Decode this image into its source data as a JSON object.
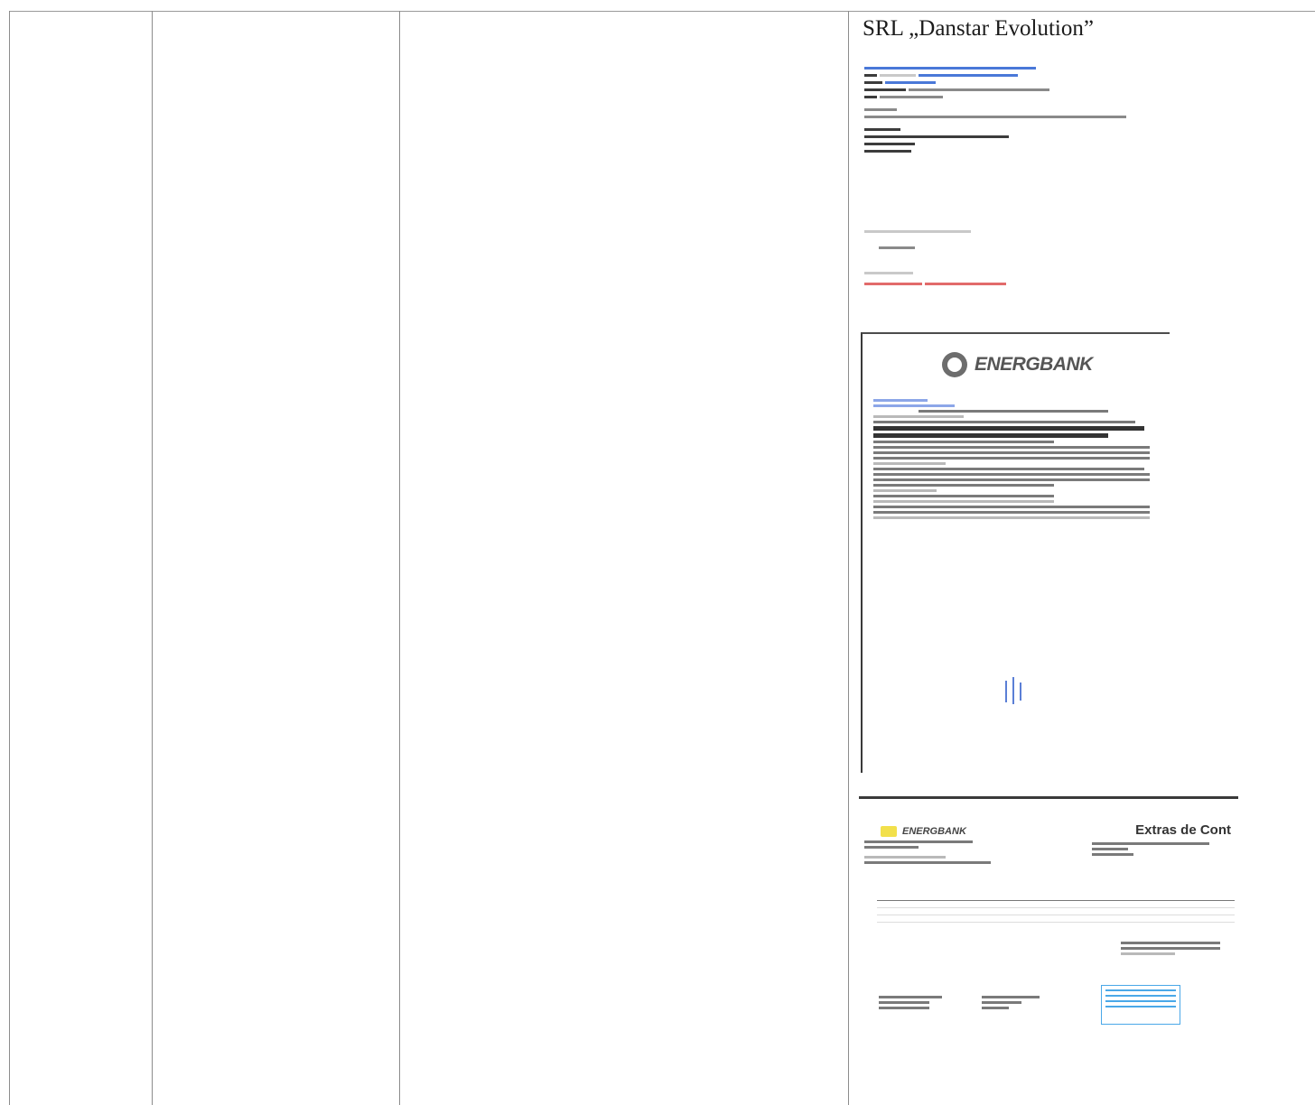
{
  "document": {
    "company_title": "SRL „Danstar Evolution”",
    "bank_name": "ENERGBANK",
    "extras_title": "Extras de Cont"
  }
}
